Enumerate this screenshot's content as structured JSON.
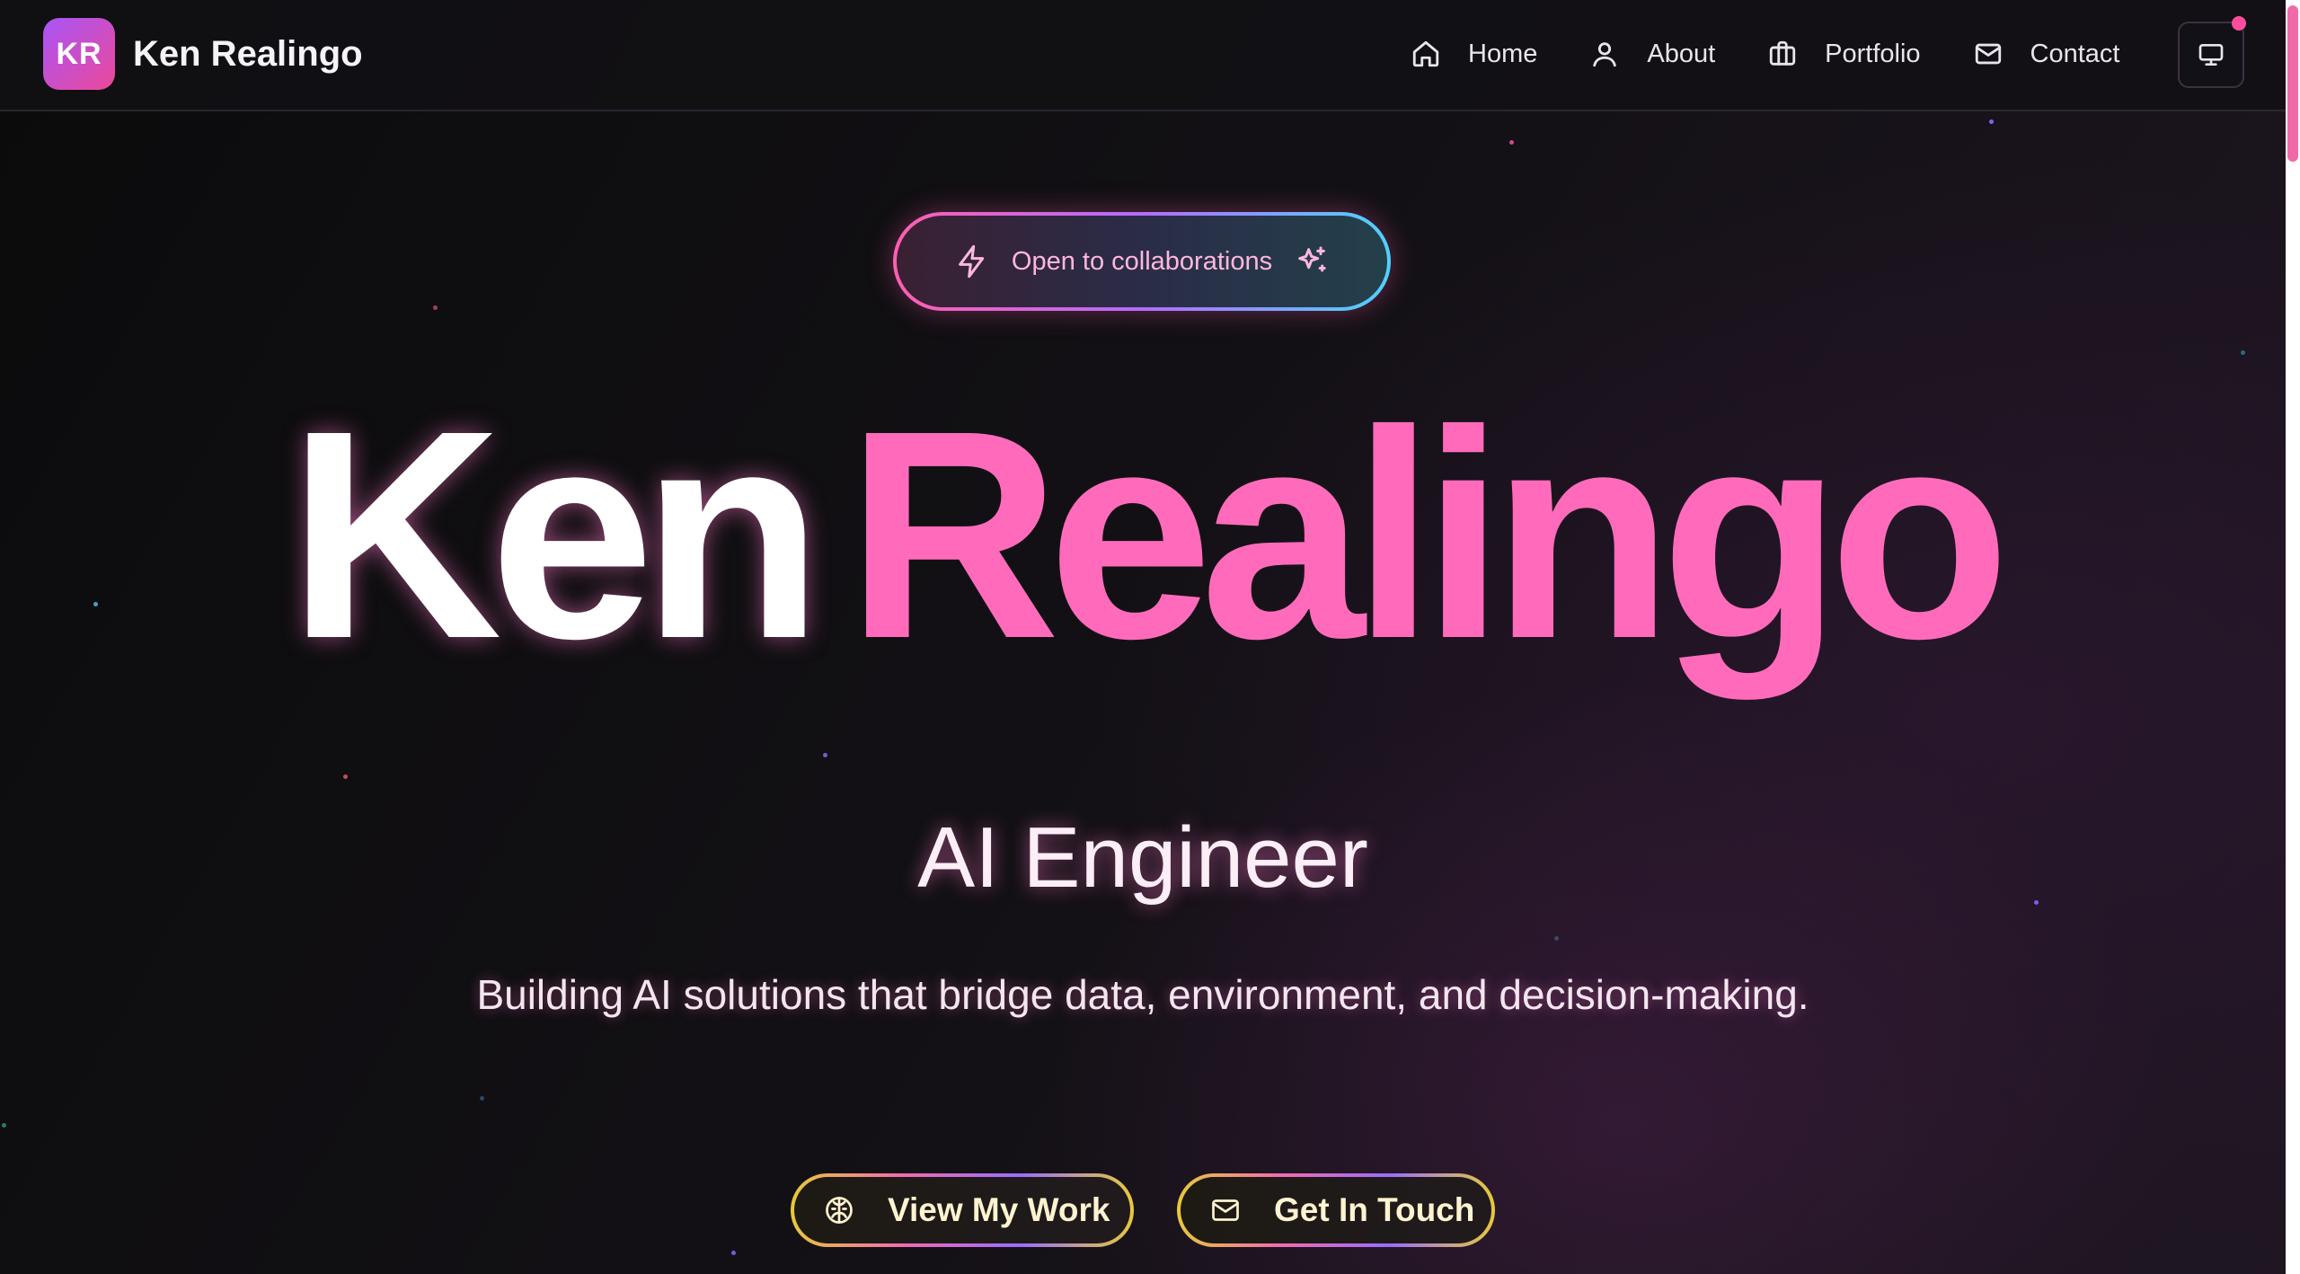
{
  "brand": {
    "initials": "KR",
    "name": "Ken Realingo"
  },
  "nav": {
    "items": [
      {
        "label": "Home",
        "icon": "home-icon"
      },
      {
        "label": "About",
        "icon": "user-icon"
      },
      {
        "label": "Portfolio",
        "icon": "briefcase-icon"
      },
      {
        "label": "Contact",
        "icon": "mail-icon"
      }
    ],
    "device_toggle_icon": "monitor-icon"
  },
  "badge": {
    "text": "Open to collaborations",
    "left_icon": "lightning-icon",
    "right_icon": "sparkles-icon"
  },
  "hero": {
    "first_name": "Ken",
    "last_name": "Realingo",
    "role": "AI Engineer",
    "tagline": "Building AI solutions that bridge data, environment, and decision-making."
  },
  "cta": {
    "primary": {
      "label": "View My Work",
      "icon": "brain-icon"
    },
    "secondary": {
      "label": "Get In Touch",
      "icon": "mail-icon"
    }
  },
  "colors": {
    "accent_pink": "#ff6bba",
    "logo_gradient_start": "#a855f7",
    "logo_gradient_end": "#ec4899",
    "notification_dot": "#ff4d9d",
    "background": "#0c0b0e"
  }
}
